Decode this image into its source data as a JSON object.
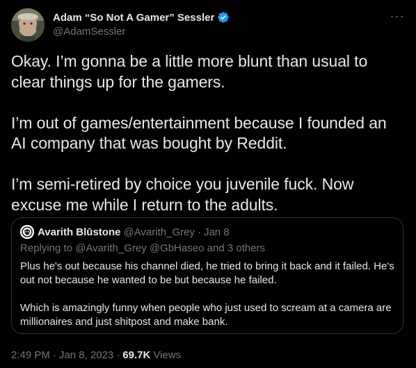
{
  "tweet": {
    "author": {
      "display_name": "Adam “So Not A Gamer” Sessler",
      "handle": "@AdamSessler",
      "verified_icon": "verified-badge-icon",
      "verified_color": "#1d9bf0"
    },
    "more_icon": "more-options-icon",
    "more_label": "···",
    "paragraphs": [
      "Okay. I’m gonna be a little more blunt than usual to clear things up for the gamers.",
      "I’m out of games/entertainment because I founded an AI company that was bought by Reddit.",
      "I’m semi-retired by choice you juvenile fuck.  Now excuse me while I return to the adults."
    ],
    "quoted": {
      "display_name": "Avarith Blūstone",
      "handle": "@Avarith_Grey",
      "dot": "·",
      "date": "Jan 8",
      "reply_prefix": "Replying to",
      "reply_mentions": "@Avarith_Grey @GbHaseo",
      "reply_suffix": "and 3 others",
      "paragraphs": [
        "Plus he's out because his channel died, he tried to bring it back and it failed. He's out not because he wanted to be but because he failed.",
        "Which is amazingly funny when people who just used to scream at a camera are millionaires and just shitpost and make bank."
      ]
    },
    "meta": {
      "time": "2:49 PM",
      "dot": "·",
      "date": "Jan 8, 2023",
      "dot2": "·",
      "views_count": "69.7K",
      "views_label": "Views"
    }
  },
  "colors": {
    "background": "#000000",
    "text_primary": "#e7e9ea",
    "text_secondary": "#71767b",
    "border": "#2f3336",
    "accent": "#1d9bf0"
  }
}
